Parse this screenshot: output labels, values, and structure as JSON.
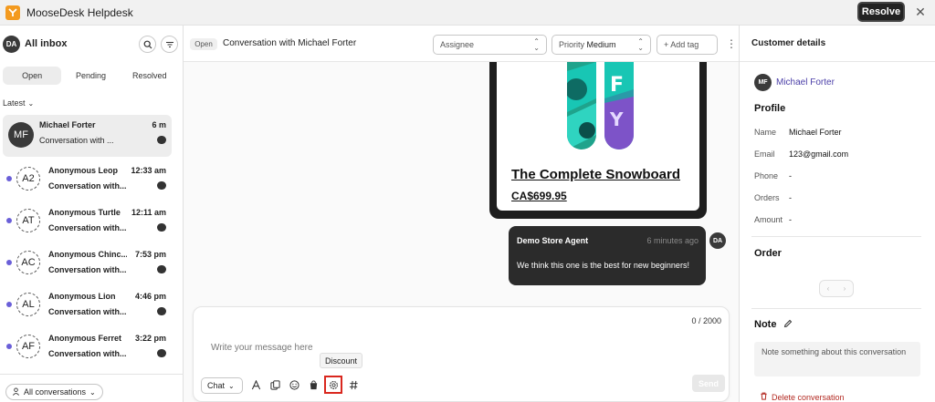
{
  "app": {
    "title": "MooseDesk Helpdesk",
    "resolve_label": "Resolve",
    "close_glyph": "✕"
  },
  "inbox": {
    "avatar": "DA",
    "title": "All inbox",
    "tabs": [
      {
        "label": "Open",
        "active": true
      },
      {
        "label": "Pending",
        "active": false
      },
      {
        "label": "Resolved",
        "active": false
      }
    ],
    "sort_label": "Latest",
    "conversations": [
      {
        "avatar": "MF",
        "name": "Michael Forter",
        "time": "6 m",
        "preview": "Conversation with ...",
        "unread": false,
        "selected": true
      },
      {
        "avatar": "A2",
        "name": "Anonymous Leop...",
        "time": "12:33 am",
        "preview": "Conversation with...",
        "unread": true,
        "selected": false
      },
      {
        "avatar": "AT",
        "name": "Anonymous Turtle",
        "time": "12:11 am",
        "preview": "Conversation with...",
        "unread": true,
        "selected": false
      },
      {
        "avatar": "AC",
        "name": "Anonymous Chinc...",
        "time": "7:53 pm",
        "preview": "Conversation with...",
        "unread": true,
        "selected": false
      },
      {
        "avatar": "AL",
        "name": "Anonymous Lion",
        "time": "4:46 pm",
        "preview": "Conversation with...",
        "unread": true,
        "selected": false
      },
      {
        "avatar": "AF",
        "name": "Anonymous Ferret",
        "time": "3:22 pm",
        "preview": "Conversation with...",
        "unread": true,
        "selected": false
      }
    ],
    "filter_label": "All conversations"
  },
  "conversation": {
    "status": "Open",
    "title": "Conversation with Michael Forter",
    "assignee_placeholder": "Assignee",
    "priority_label": "Priority",
    "priority_value": "Medium",
    "add_tag_label": "+ Add tag",
    "product": {
      "name": "The Complete Snowboard",
      "price": "CA$699.95"
    },
    "agent_message": {
      "sender": "Demo Store Agent",
      "time": "6 minutes ago",
      "text": "We think this one is the best for new beginners!",
      "avatar": "DA"
    },
    "composer": {
      "char_count": "0 / 2000",
      "placeholder": "Write your message here",
      "channel": "Chat",
      "tooltip": "Discount",
      "send_label": "Send",
      "tools": [
        "text-format-icon",
        "attachment-icon",
        "emoji-icon",
        "shopify-bag-icon",
        "discount-gear-icon",
        "hashtag-icon"
      ]
    }
  },
  "customer": {
    "panel_title": "Customer details",
    "avatar": "MF",
    "name": "Michael Forter",
    "profile_title": "Profile",
    "fields": [
      {
        "label": "Name",
        "value": "Michael Forter"
      },
      {
        "label": "Email",
        "value": "123@gmail.com"
      },
      {
        "label": "Phone",
        "value": "-"
      },
      {
        "label": "Orders",
        "value": "-"
      },
      {
        "label": "Amount",
        "value": "-"
      }
    ],
    "order_title": "Order",
    "note_title": "Note",
    "note_placeholder": "Note something about this conversation",
    "delete_label": "Delete conversation"
  },
  "colors": {
    "accent": "#6a5fd8",
    "dark": "#222222",
    "danger": "#d9271e",
    "brand_orange": "#f39a1f"
  }
}
